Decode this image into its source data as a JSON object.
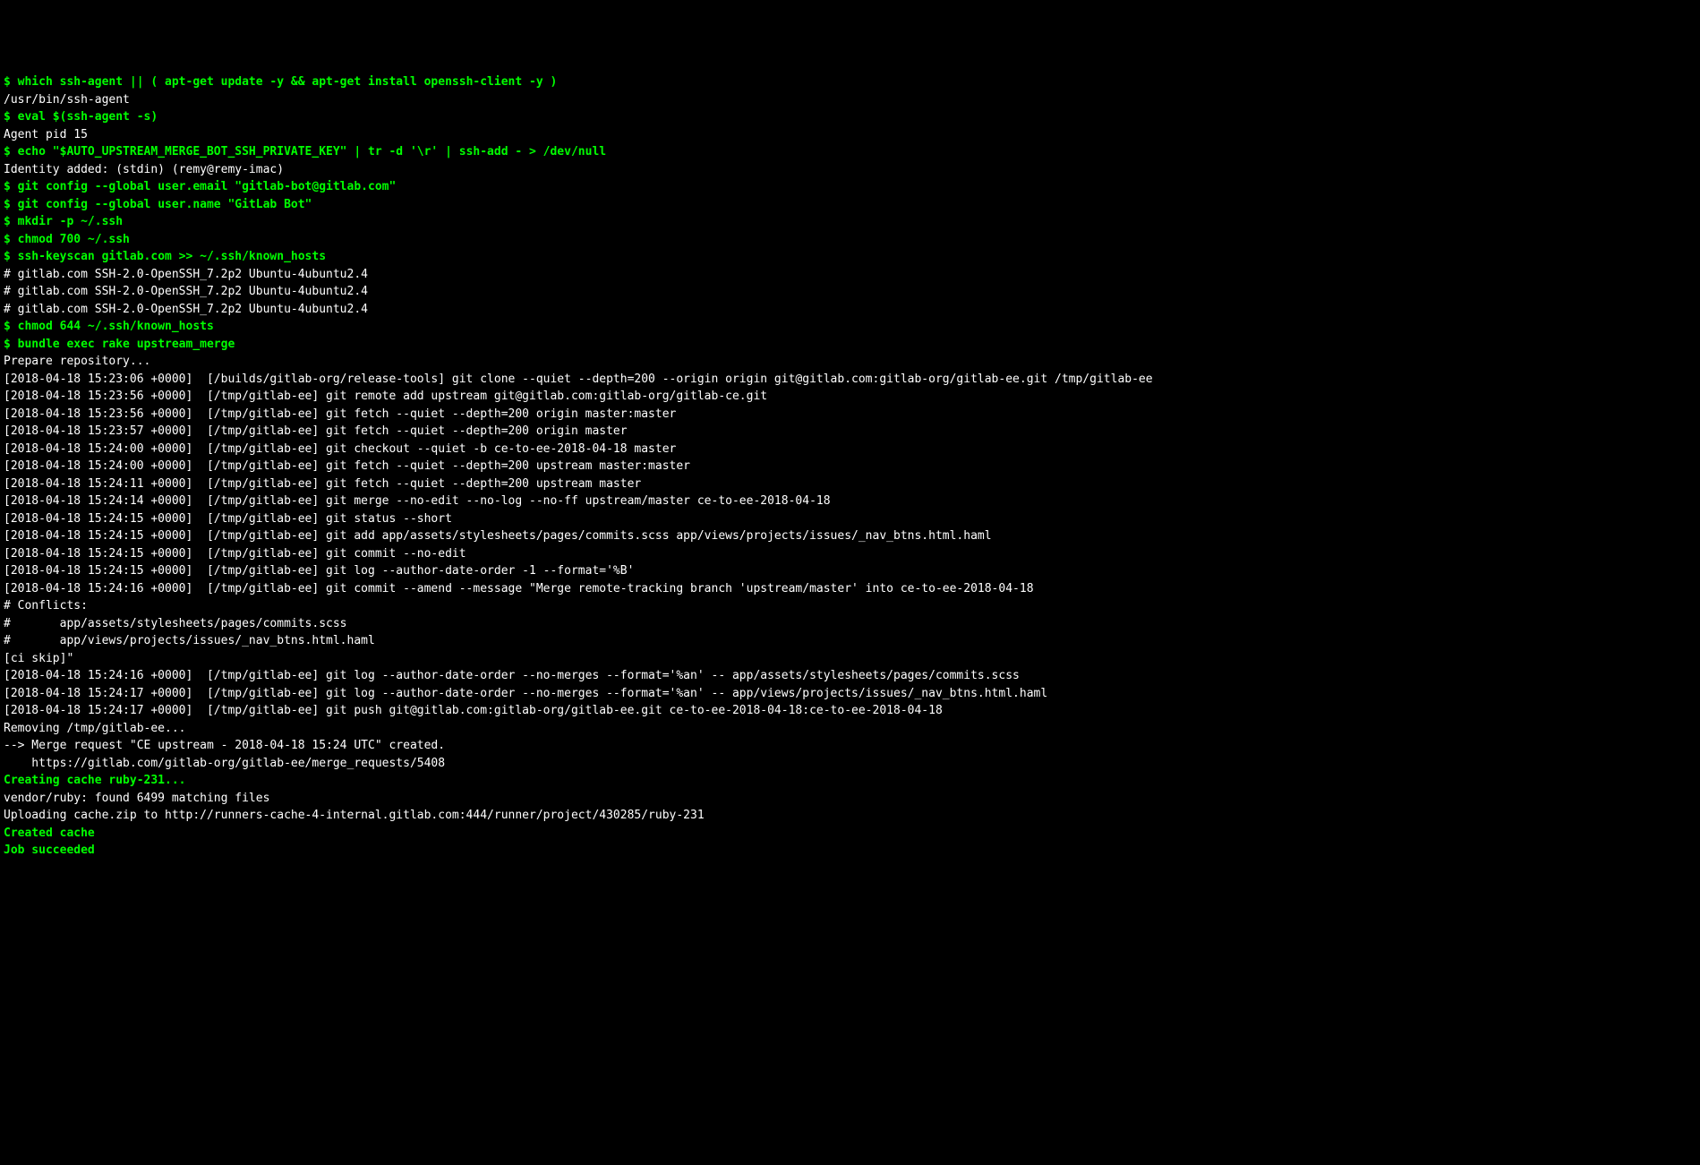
{
  "terminal": {
    "lines": [
      {
        "type": "cmd",
        "prompt": "$ ",
        "text": "which ssh-agent || ( apt-get update -y && apt-get install openssh-client -y )"
      },
      {
        "type": "out",
        "text": "/usr/bin/ssh-agent"
      },
      {
        "type": "cmd",
        "prompt": "$ ",
        "text": "eval $(ssh-agent -s)"
      },
      {
        "type": "out",
        "text": "Agent pid 15"
      },
      {
        "type": "cmd",
        "prompt": "$ ",
        "text": "echo \"$AUTO_UPSTREAM_MERGE_BOT_SSH_PRIVATE_KEY\" | tr -d '\\r' | ssh-add - > /dev/null"
      },
      {
        "type": "out",
        "text": "Identity added: (stdin) (remy@remy-imac)"
      },
      {
        "type": "cmd",
        "prompt": "$ ",
        "text": "git config --global user.email \"gitlab-bot@gitlab.com\""
      },
      {
        "type": "cmd",
        "prompt": "$ ",
        "text": "git config --global user.name \"GitLab Bot\""
      },
      {
        "type": "cmd",
        "prompt": "$ ",
        "text": "mkdir -p ~/.ssh"
      },
      {
        "type": "cmd",
        "prompt": "$ ",
        "text": "chmod 700 ~/.ssh"
      },
      {
        "type": "cmd",
        "prompt": "$ ",
        "text": "ssh-keyscan gitlab.com >> ~/.ssh/known_hosts"
      },
      {
        "type": "out",
        "text": "# gitlab.com SSH-2.0-OpenSSH_7.2p2 Ubuntu-4ubuntu2.4"
      },
      {
        "type": "out",
        "text": "# gitlab.com SSH-2.0-OpenSSH_7.2p2 Ubuntu-4ubuntu2.4"
      },
      {
        "type": "out",
        "text": "# gitlab.com SSH-2.0-OpenSSH_7.2p2 Ubuntu-4ubuntu2.4"
      },
      {
        "type": "cmd",
        "prompt": "$ ",
        "text": "chmod 644 ~/.ssh/known_hosts"
      },
      {
        "type": "cmd",
        "prompt": "$ ",
        "text": "bundle exec rake upstream_merge"
      },
      {
        "type": "out",
        "text": "Prepare repository..."
      },
      {
        "type": "out",
        "text": "[2018-04-18 15:23:06 +0000]  [/builds/gitlab-org/release-tools] git clone --quiet --depth=200 --origin origin git@gitlab.com:gitlab-org/gitlab-ee.git /tmp/gitlab-ee"
      },
      {
        "type": "out",
        "text": "[2018-04-18 15:23:56 +0000]  [/tmp/gitlab-ee] git remote add upstream git@gitlab.com:gitlab-org/gitlab-ce.git"
      },
      {
        "type": "out",
        "text": "[2018-04-18 15:23:56 +0000]  [/tmp/gitlab-ee] git fetch --quiet --depth=200 origin master:master"
      },
      {
        "type": "out",
        "text": "[2018-04-18 15:23:57 +0000]  [/tmp/gitlab-ee] git fetch --quiet --depth=200 origin master"
      },
      {
        "type": "out",
        "text": "[2018-04-18 15:24:00 +0000]  [/tmp/gitlab-ee] git checkout --quiet -b ce-to-ee-2018-04-18 master"
      },
      {
        "type": "out",
        "text": "[2018-04-18 15:24:00 +0000]  [/tmp/gitlab-ee] git fetch --quiet --depth=200 upstream master:master"
      },
      {
        "type": "out",
        "text": "[2018-04-18 15:24:11 +0000]  [/tmp/gitlab-ee] git fetch --quiet --depth=200 upstream master"
      },
      {
        "type": "out",
        "text": "[2018-04-18 15:24:14 +0000]  [/tmp/gitlab-ee] git merge --no-edit --no-log --no-ff upstream/master ce-to-ee-2018-04-18"
      },
      {
        "type": "out",
        "text": "[2018-04-18 15:24:15 +0000]  [/tmp/gitlab-ee] git status --short"
      },
      {
        "type": "out",
        "text": "[2018-04-18 15:24:15 +0000]  [/tmp/gitlab-ee] git add app/assets/stylesheets/pages/commits.scss app/views/projects/issues/_nav_btns.html.haml"
      },
      {
        "type": "out",
        "text": "[2018-04-18 15:24:15 +0000]  [/tmp/gitlab-ee] git commit --no-edit"
      },
      {
        "type": "out",
        "text": "[2018-04-18 15:24:15 +0000]  [/tmp/gitlab-ee] git log --author-date-order -1 --format='%B'"
      },
      {
        "type": "out",
        "text": "[2018-04-18 15:24:16 +0000]  [/tmp/gitlab-ee] git commit --amend --message \"Merge remote-tracking branch 'upstream/master' into ce-to-ee-2018-04-18"
      },
      {
        "type": "out",
        "text": ""
      },
      {
        "type": "out",
        "text": "# Conflicts:"
      },
      {
        "type": "out",
        "text": "#       app/assets/stylesheets/pages/commits.scss"
      },
      {
        "type": "out",
        "text": "#       app/views/projects/issues/_nav_btns.html.haml"
      },
      {
        "type": "out",
        "text": ""
      },
      {
        "type": "out",
        "text": "[ci skip]\""
      },
      {
        "type": "out",
        "text": "[2018-04-18 15:24:16 +0000]  [/tmp/gitlab-ee] git log --author-date-order --no-merges --format='%an' -- app/assets/stylesheets/pages/commits.scss"
      },
      {
        "type": "out",
        "text": "[2018-04-18 15:24:17 +0000]  [/tmp/gitlab-ee] git log --author-date-order --no-merges --format='%an' -- app/views/projects/issues/_nav_btns.html.haml"
      },
      {
        "type": "out",
        "text": "[2018-04-18 15:24:17 +0000]  [/tmp/gitlab-ee] git push git@gitlab.com:gitlab-org/gitlab-ee.git ce-to-ee-2018-04-18:ce-to-ee-2018-04-18"
      },
      {
        "type": "out",
        "text": "Removing /tmp/gitlab-ee..."
      },
      {
        "type": "out",
        "text": "--> Merge request \"CE upstream - 2018-04-18 15:24 UTC\" created."
      },
      {
        "type": "out",
        "text": "    https://gitlab.com/gitlab-org/gitlab-ee/merge_requests/5408"
      },
      {
        "type": "bold-green",
        "text": "Creating cache ruby-231..."
      },
      {
        "type": "out",
        "text": "vendor/ruby: found 6499 matching files"
      },
      {
        "type": "out",
        "text": "Uploading cache.zip to http://runners-cache-4-internal.gitlab.com:444/runner/project/430285/ruby-231"
      },
      {
        "type": "bold-green",
        "text": "Created cache"
      },
      {
        "type": "bold-green",
        "text": "Job succeeded"
      }
    ]
  }
}
